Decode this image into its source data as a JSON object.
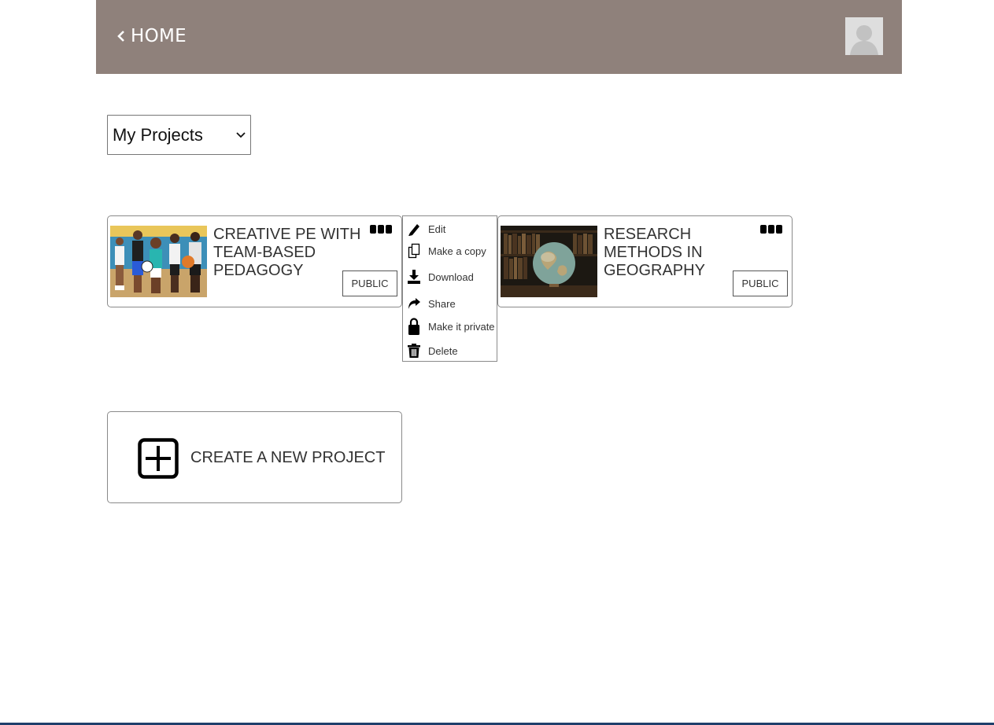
{
  "header": {
    "home_label": "HOME",
    "background_color": "#8f817b"
  },
  "filter": {
    "selected": "My Projects"
  },
  "projects": [
    {
      "title": "CREATIVE PE WITH TEAM-BASED PEDAGOGY",
      "visibility": "PUBLIC"
    },
    {
      "title": "RESEARCH METHODS IN GEOGRAPHY",
      "visibility": "PUBLIC"
    }
  ],
  "context_menu": {
    "items": [
      {
        "label": "Edit",
        "icon": "pencil-icon"
      },
      {
        "label": "Make a copy",
        "icon": "copy-icon"
      },
      {
        "label": "Download",
        "icon": "download-icon"
      },
      {
        "label": "Share",
        "icon": "share-icon"
      },
      {
        "label": "Make it private",
        "icon": "lock-icon"
      },
      {
        "label": "Delete",
        "icon": "trash-icon"
      }
    ]
  },
  "create": {
    "label": "CREATE A NEW PROJECT"
  }
}
